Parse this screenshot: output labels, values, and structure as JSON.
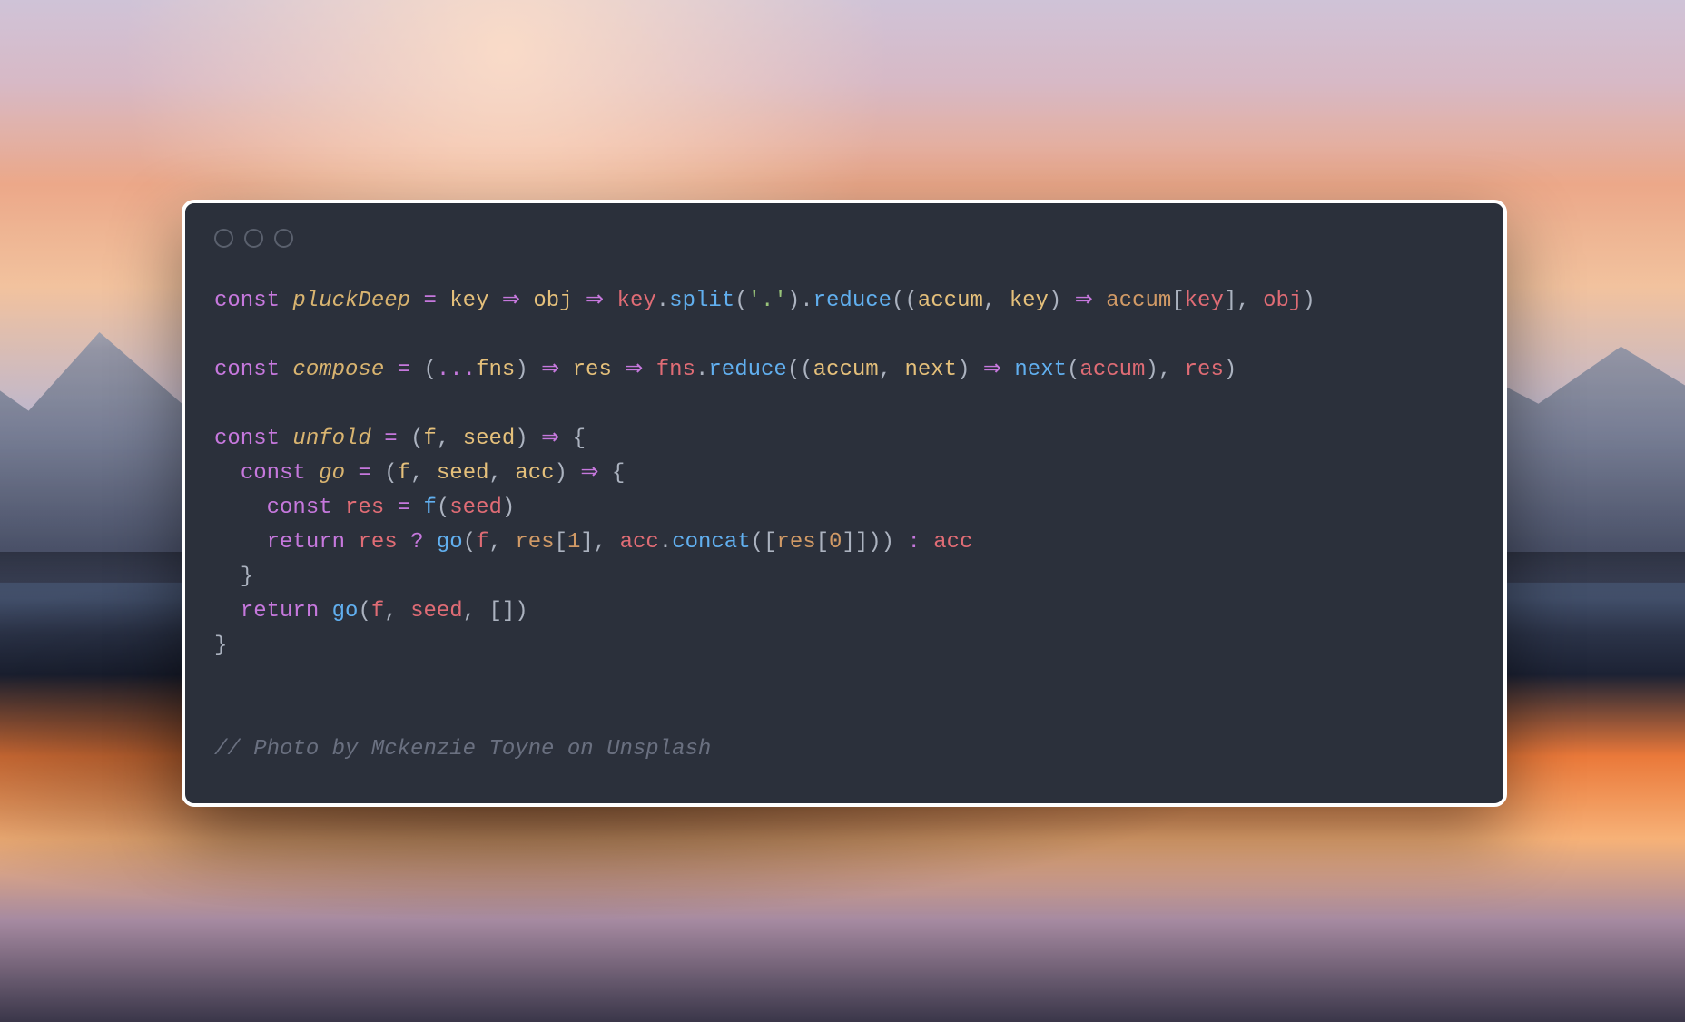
{
  "code": {
    "lines": [
      [
        {
          "t": "const ",
          "c": "kw"
        },
        {
          "t": "pluckDeep",
          "c": "fn"
        },
        {
          "t": " = ",
          "c": "op"
        },
        {
          "t": "key",
          "c": "pr"
        },
        {
          "t": " ",
          "c": "pun"
        },
        {
          "t": "=>",
          "c": "ar"
        },
        {
          "t": " ",
          "c": "pun"
        },
        {
          "t": "obj",
          "c": "pr"
        },
        {
          "t": " ",
          "c": "pun"
        },
        {
          "t": "=>",
          "c": "ar"
        },
        {
          "t": " ",
          "c": "pun"
        },
        {
          "t": "key",
          "c": "id"
        },
        {
          "t": ".",
          "c": "pun"
        },
        {
          "t": "split",
          "c": "call"
        },
        {
          "t": "(",
          "c": "pun"
        },
        {
          "t": "'.'",
          "c": "str"
        },
        {
          "t": ")",
          "c": "pun"
        },
        {
          "t": ".",
          "c": "pun"
        },
        {
          "t": "reduce",
          "c": "call"
        },
        {
          "t": "((",
          "c": "pun"
        },
        {
          "t": "accum",
          "c": "pr"
        },
        {
          "t": ", ",
          "c": "pun"
        },
        {
          "t": "key",
          "c": "pr"
        },
        {
          "t": ") ",
          "c": "pun"
        },
        {
          "t": "=>",
          "c": "ar"
        },
        {
          "t": " ",
          "c": "pun"
        },
        {
          "t": "accum",
          "c": "obj"
        },
        {
          "t": "[",
          "c": "pun"
        },
        {
          "t": "key",
          "c": "id"
        },
        {
          "t": "]",
          "c": "pun"
        },
        {
          "t": ", ",
          "c": "pun"
        },
        {
          "t": "obj",
          "c": "id"
        },
        {
          "t": ")",
          "c": "pun"
        }
      ],
      [],
      [
        {
          "t": "const ",
          "c": "kw"
        },
        {
          "t": "compose",
          "c": "fn"
        },
        {
          "t": " = ",
          "c": "op"
        },
        {
          "t": "(",
          "c": "pun"
        },
        {
          "t": "...",
          "c": "op"
        },
        {
          "t": "fns",
          "c": "pr"
        },
        {
          "t": ") ",
          "c": "pun"
        },
        {
          "t": "=>",
          "c": "ar"
        },
        {
          "t": " ",
          "c": "pun"
        },
        {
          "t": "res",
          "c": "pr"
        },
        {
          "t": " ",
          "c": "pun"
        },
        {
          "t": "=>",
          "c": "ar"
        },
        {
          "t": " ",
          "c": "pun"
        },
        {
          "t": "fns",
          "c": "id"
        },
        {
          "t": ".",
          "c": "pun"
        },
        {
          "t": "reduce",
          "c": "call"
        },
        {
          "t": "((",
          "c": "pun"
        },
        {
          "t": "accum",
          "c": "pr"
        },
        {
          "t": ", ",
          "c": "pun"
        },
        {
          "t": "next",
          "c": "pr"
        },
        {
          "t": ") ",
          "c": "pun"
        },
        {
          "t": "=>",
          "c": "ar"
        },
        {
          "t": " ",
          "c": "pun"
        },
        {
          "t": "next",
          "c": "call"
        },
        {
          "t": "(",
          "c": "pun"
        },
        {
          "t": "accum",
          "c": "id"
        },
        {
          "t": ")",
          "c": "pun"
        },
        {
          "t": ", ",
          "c": "pun"
        },
        {
          "t": "res",
          "c": "id"
        },
        {
          "t": ")",
          "c": "pun"
        }
      ],
      [],
      [
        {
          "t": "const ",
          "c": "kw"
        },
        {
          "t": "unfold",
          "c": "fn"
        },
        {
          "t": " = ",
          "c": "op"
        },
        {
          "t": "(",
          "c": "pun"
        },
        {
          "t": "f",
          "c": "pr"
        },
        {
          "t": ", ",
          "c": "pun"
        },
        {
          "t": "seed",
          "c": "pr"
        },
        {
          "t": ") ",
          "c": "pun"
        },
        {
          "t": "=>",
          "c": "ar"
        },
        {
          "t": " {",
          "c": "pun"
        }
      ],
      [
        {
          "t": "  ",
          "c": "pun"
        },
        {
          "t": "const ",
          "c": "kw"
        },
        {
          "t": "go",
          "c": "fn"
        },
        {
          "t": " = ",
          "c": "op"
        },
        {
          "t": "(",
          "c": "pun"
        },
        {
          "t": "f",
          "c": "pr"
        },
        {
          "t": ", ",
          "c": "pun"
        },
        {
          "t": "seed",
          "c": "pr"
        },
        {
          "t": ", ",
          "c": "pun"
        },
        {
          "t": "acc",
          "c": "pr"
        },
        {
          "t": ") ",
          "c": "pun"
        },
        {
          "t": "=>",
          "c": "ar"
        },
        {
          "t": " {",
          "c": "pun"
        }
      ],
      [
        {
          "t": "    ",
          "c": "pun"
        },
        {
          "t": "const ",
          "c": "kw"
        },
        {
          "t": "res",
          "c": "id"
        },
        {
          "t": " = ",
          "c": "op"
        },
        {
          "t": "f",
          "c": "call"
        },
        {
          "t": "(",
          "c": "pun"
        },
        {
          "t": "seed",
          "c": "id"
        },
        {
          "t": ")",
          "c": "pun"
        }
      ],
      [
        {
          "t": "    ",
          "c": "pun"
        },
        {
          "t": "return ",
          "c": "kw"
        },
        {
          "t": "res",
          "c": "id"
        },
        {
          "t": " ",
          "c": "pun"
        },
        {
          "t": "?",
          "c": "op"
        },
        {
          "t": " ",
          "c": "pun"
        },
        {
          "t": "go",
          "c": "call"
        },
        {
          "t": "(",
          "c": "pun"
        },
        {
          "t": "f",
          "c": "id"
        },
        {
          "t": ", ",
          "c": "pun"
        },
        {
          "t": "res",
          "c": "obj"
        },
        {
          "t": "[",
          "c": "pun"
        },
        {
          "t": "1",
          "c": "num"
        },
        {
          "t": "]",
          "c": "pun"
        },
        {
          "t": ", ",
          "c": "pun"
        },
        {
          "t": "acc",
          "c": "id"
        },
        {
          "t": ".",
          "c": "pun"
        },
        {
          "t": "concat",
          "c": "call"
        },
        {
          "t": "([",
          "c": "pun"
        },
        {
          "t": "res",
          "c": "obj"
        },
        {
          "t": "[",
          "c": "pun"
        },
        {
          "t": "0",
          "c": "num"
        },
        {
          "t": "]]))",
          "c": "pun"
        },
        {
          "t": " ",
          "c": "pun"
        },
        {
          "t": ":",
          "c": "op"
        },
        {
          "t": " ",
          "c": "pun"
        },
        {
          "t": "acc",
          "c": "id"
        }
      ],
      [
        {
          "t": "  }",
          "c": "pun"
        }
      ],
      [
        {
          "t": "  ",
          "c": "pun"
        },
        {
          "t": "return ",
          "c": "kw"
        },
        {
          "t": "go",
          "c": "call"
        },
        {
          "t": "(",
          "c": "pun"
        },
        {
          "t": "f",
          "c": "id"
        },
        {
          "t": ", ",
          "c": "pun"
        },
        {
          "t": "seed",
          "c": "id"
        },
        {
          "t": ", [])",
          "c": "pun"
        }
      ],
      [
        {
          "t": "}",
          "c": "pun"
        }
      ],
      [],
      [],
      [
        {
          "t": "// Photo by Mckenzie Toyne on Unsplash",
          "c": "cmt"
        }
      ]
    ]
  }
}
